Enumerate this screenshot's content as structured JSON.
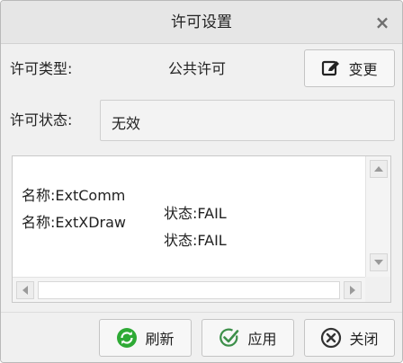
{
  "dialog": {
    "title": "许可设置",
    "close_label": "×"
  },
  "license_type": {
    "label": "许可类型:",
    "value": "公共许可",
    "change_button": "变更"
  },
  "license_status": {
    "label": "许可状态:",
    "value": "无效"
  },
  "license_list": {
    "rows": [
      {
        "name": "名称:ExtComm",
        "status": "状态:FAIL"
      },
      {
        "name": "名称:ExtXDraw",
        "status": "状态:FAIL"
      }
    ]
  },
  "footer": {
    "refresh_label": "刷新",
    "apply_label": "应用",
    "close_label": "关闭"
  },
  "colors": {
    "refresh_icon": "#2eaa35",
    "apply_icon": "#3d8f4a",
    "close_icon": "#333333"
  }
}
